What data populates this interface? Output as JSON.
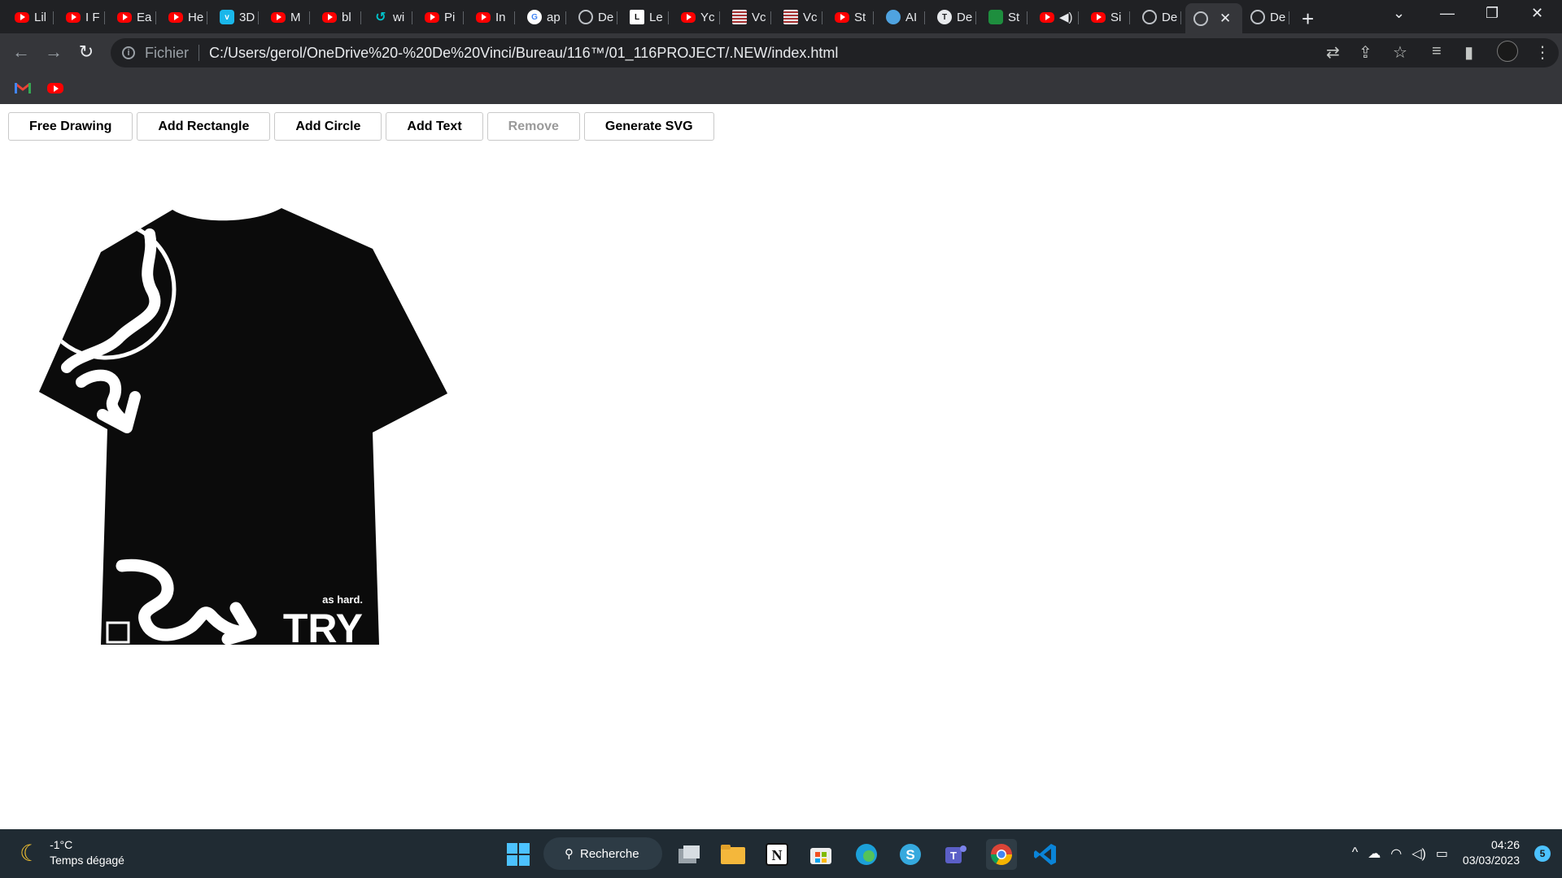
{
  "browser": {
    "tabs": [
      {
        "icon": "youtube-icon",
        "label": "Lil"
      },
      {
        "icon": "youtube-icon",
        "label": "I F"
      },
      {
        "icon": "youtube-icon",
        "label": "Ea"
      },
      {
        "icon": "youtube-icon",
        "label": "He"
      },
      {
        "icon": "vimeo-icon",
        "label": "3D"
      },
      {
        "icon": "youtube-icon",
        "label": "M"
      },
      {
        "icon": "youtube-icon",
        "label": "bl"
      },
      {
        "icon": "canva-icon",
        "label": "wi"
      },
      {
        "icon": "youtube-icon",
        "label": "Pi"
      },
      {
        "icon": "youtube-icon",
        "label": "In"
      },
      {
        "icon": "google-icon",
        "label": "ap"
      },
      {
        "icon": "globe-icon",
        "label": "De"
      },
      {
        "icon": "lemonde-icon",
        "label": "Le"
      },
      {
        "icon": "youtube-icon",
        "label": "Yc"
      },
      {
        "icon": "stripes-icon",
        "label": "Vc"
      },
      {
        "icon": "stripes-icon",
        "label": "Vc"
      },
      {
        "icon": "youtube-icon",
        "label": "St"
      },
      {
        "icon": "chatbot-icon",
        "label": "AI"
      },
      {
        "icon": "tshirt-icon",
        "label": "De"
      },
      {
        "icon": "green-icon",
        "label": "St"
      },
      {
        "icon": "youtube-icon",
        "label": "◀)"
      },
      {
        "icon": "youtube-icon",
        "label": "Si"
      },
      {
        "icon": "globe-icon",
        "label": "De"
      },
      {
        "icon": "globe-icon",
        "label": "",
        "active": true
      },
      {
        "icon": "globe-icon",
        "label": "De"
      }
    ],
    "address": {
      "scheme_label": "Fichier",
      "url": "C:/Users/gerol/OneDrive%20-%20De%20Vinci/Bureau/116™/01_116PROJECT/.NEW/index.html"
    },
    "bookmarks": [
      "gmail-icon",
      "youtube-icon"
    ]
  },
  "toolbar": {
    "buttons": [
      {
        "label": "Free Drawing",
        "enabled": true
      },
      {
        "label": "Add Rectangle",
        "enabled": true
      },
      {
        "label": "Add Circle",
        "enabled": true
      },
      {
        "label": "Add Text",
        "enabled": true
      },
      {
        "label": "Remove",
        "enabled": false
      },
      {
        "label": "Generate SVG",
        "enabled": true
      }
    ]
  },
  "canvas": {
    "shirt_color": "#0b0b0b",
    "print_color": "#ffffff",
    "small_text": "as hard.",
    "big_text": "TRY"
  },
  "taskbar": {
    "weather": {
      "temperature": "-1°C",
      "condition": "Temps dégagé"
    },
    "search_label": "Recherche",
    "apps": [
      "windows-start-icon",
      "task-view-icon",
      "file-explorer-icon",
      "notion-icon",
      "microsoft-store-icon",
      "edge-icon",
      "skype-icon",
      "teams-icon",
      "chrome-icon",
      "vscode-icon"
    ],
    "clock": {
      "time": "04:26",
      "date": "03/03/2023"
    },
    "notification_count": "5"
  }
}
